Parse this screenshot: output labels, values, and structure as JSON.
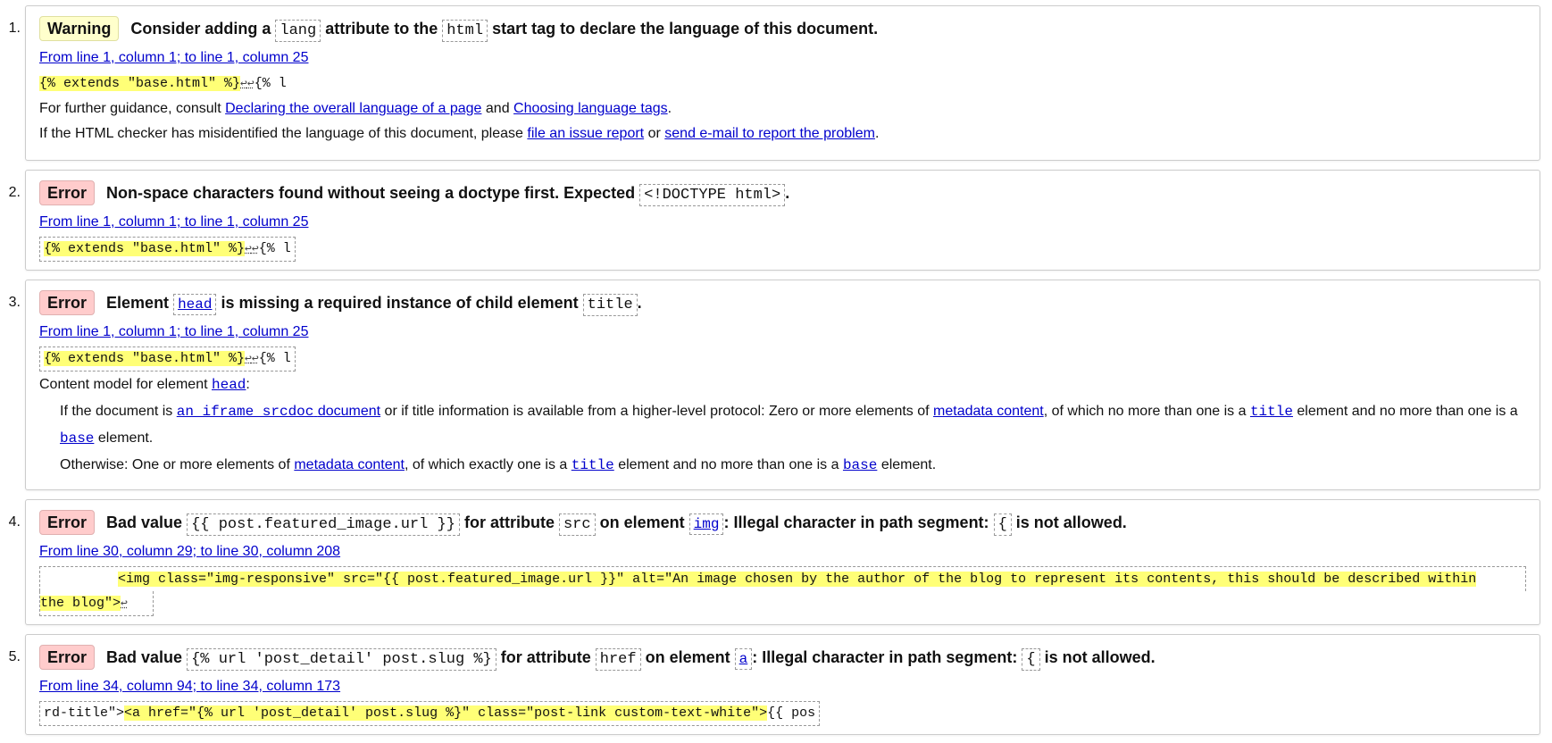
{
  "messages": [
    {
      "num": "1.",
      "type": "Warning",
      "parts": {
        "a": "Consider adding a",
        "code1": "lang",
        "b": "attribute to the",
        "code2": "html",
        "c": "start tag to declare the language of this document."
      },
      "location": "From line 1, column 1; to line 1, column 25",
      "extract": "{% extends \"base.html\" %}",
      "extract_tail": "{% l",
      "guidance": {
        "prefix": "For further guidance, consult",
        "link1": "Declaring the overall language of a page",
        "and": "and",
        "link2": "Choosing language tags",
        "end": "."
      },
      "misidentified": {
        "prefix": "If the HTML checker has misidentified the language of this document, please",
        "link1": "file an issue report",
        "or": "or",
        "link2": "send e-mail to report the problem",
        "end": "."
      }
    },
    {
      "num": "2.",
      "type": "Error",
      "parts": {
        "a": "Non-space characters found without seeing a doctype first. Expected",
        "code1": "<!DOCTYPE html>",
        "end": "."
      },
      "location": "From line 1, column 1; to line 1, column 25",
      "extract": "{% extends \"base.html\" %}",
      "extract_tail": "{% l"
    },
    {
      "num": "3.",
      "type": "Error",
      "parts": {
        "a": "Element",
        "code1": "head",
        "b": "is missing a required instance of child element",
        "code2": "title",
        "end": "."
      },
      "location": "From line 1, column 1; to line 1, column 25",
      "extract": "{% extends \"base.html\" %}",
      "extract_tail": "{% l",
      "content_model": {
        "prefix": "Content model for element",
        "element": "head",
        "colon": ":",
        "p1": {
          "a": "If the document is",
          "link_code": "an iframe srcdoc",
          "link_text": "document",
          "b": "or if title information is available from a higher-level protocol: Zero or more elements of",
          "link2": "metadata content",
          "c": ", of which no more than one is a",
          "code1": "title",
          "d": "element and no more than one is a",
          "code2": "base",
          "e": "element."
        },
        "p2": {
          "a": "Otherwise: One or more elements of",
          "link1": "metadata content",
          "b": ", of which exactly one is a",
          "code1": "title",
          "c": "element and no more than one is a",
          "code2": "base",
          "d": "element."
        }
      }
    },
    {
      "num": "4.",
      "type": "Error",
      "parts": {
        "a": "Bad value",
        "code1": "{{ post.featured_image.url }}",
        "b": "for attribute",
        "code2": "src",
        "c": "on element",
        "code3": "img",
        "d": ": Illegal character in path segment:",
        "code4": "{",
        "e": "is not allowed."
      },
      "location": "From line 30, column 29; to line 30, column 208",
      "extract_line1": "<img class=\"img-responsive\" src=\"{{ post.featured_image.url }}\" alt=\"An image chosen by the author of the blog to represent its contents, this should be described within",
      "extract_line2": "the blog\">"
    },
    {
      "num": "5.",
      "type": "Error",
      "parts": {
        "a": "Bad value",
        "code1": "{% url 'post_detail' post.slug %}",
        "b": "for attribute",
        "code2": "href",
        "c": "on element",
        "code3": "a",
        "d": ": Illegal character in path segment:",
        "code4": "{",
        "e": "is not allowed."
      },
      "location": "From line 34, column 94; to line 34, column 173",
      "extract_head": "rd-title\">",
      "extract": "<a href=\"{% url 'post_detail' post.slug %}\" class=\"post-link custom-text-white\">",
      "extract_tail": "{{ pos"
    }
  ],
  "return_glyph": "↩"
}
